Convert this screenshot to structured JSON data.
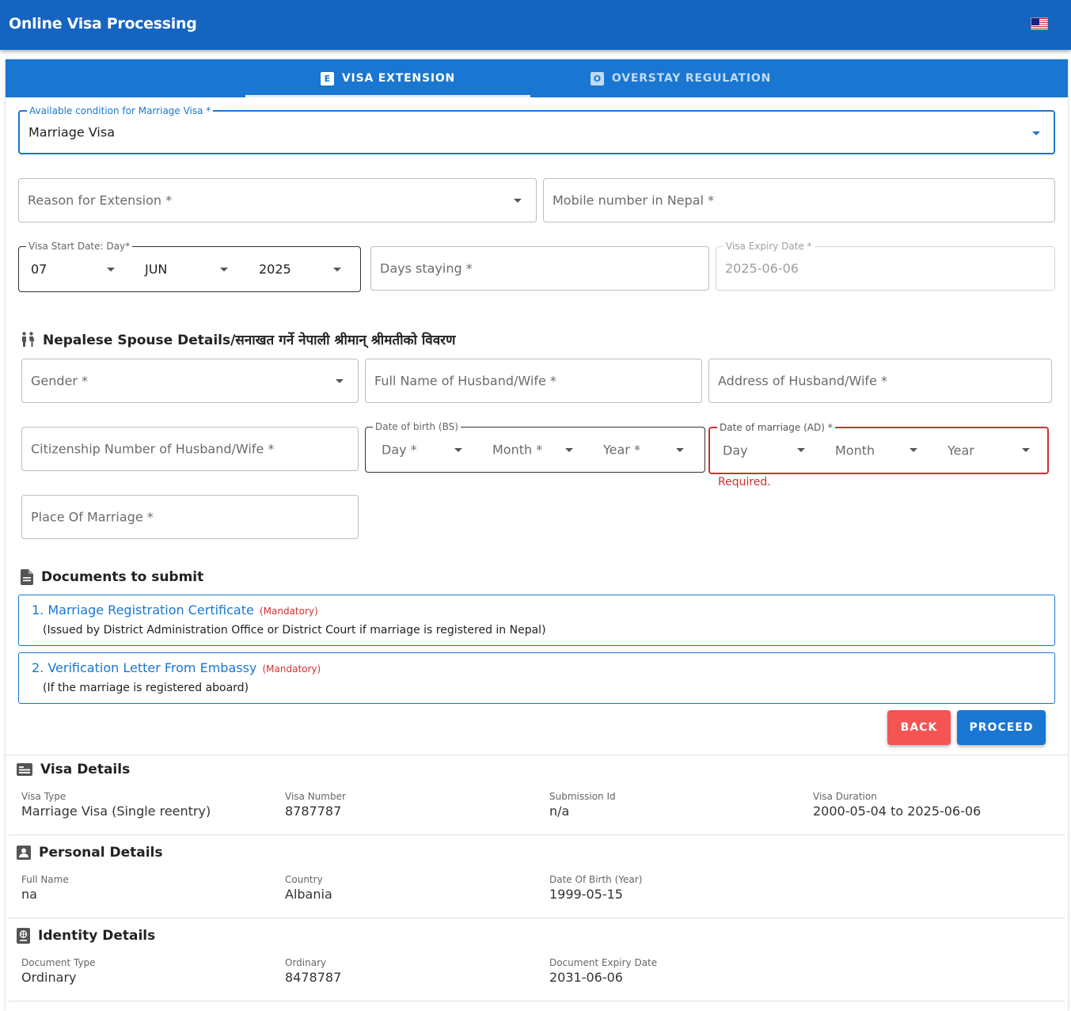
{
  "app": {
    "title": "Online Visa Processing"
  },
  "tabs": [
    {
      "badge": "E",
      "label": "VISA EXTENSION"
    },
    {
      "badge": "O",
      "label": "OVERSTAY REGULATION"
    }
  ],
  "form": {
    "condition": {
      "label": "Available condition for Marriage Visa *",
      "value": "Marriage Visa"
    },
    "reason": {
      "placeholder": "Reason for Extension *"
    },
    "mobile": {
      "placeholder": "Mobile number in Nepal *"
    },
    "visa_start": {
      "label": "Visa Start Date: Day*",
      "day": "07",
      "month": "JUN",
      "year": "2025"
    },
    "days_staying": {
      "placeholder": "Days staying *"
    },
    "visa_expiry": {
      "label": "Visa Expiry Date *",
      "value": "2025-06-06"
    }
  },
  "spouse": {
    "heading": "Nepalese Spouse Details/सनाखत गर्ने नेपाली श्रीमान् श्रीमतीको विवरण",
    "gender": {
      "placeholder": "Gender *"
    },
    "full_name": {
      "placeholder": "Full Name of Husband/Wife *"
    },
    "address": {
      "placeholder": "Address of Husband/Wife *"
    },
    "citizenship": {
      "placeholder": "Citizenship Number of Husband/Wife *"
    },
    "dob": {
      "label": "Date of birth (BS)",
      "day": "Day *",
      "month": "Month *",
      "year": "Year *"
    },
    "marriage_date": {
      "label": "Date of marriage (AD) *",
      "day": "Day",
      "month": "Month",
      "year": "Year",
      "error": "Required."
    },
    "place": {
      "placeholder": "Place Of Marriage *"
    }
  },
  "documents": {
    "heading": "Documents to submit",
    "items": [
      {
        "title": "1. Marriage Registration Certificate",
        "tag": "(Mandatory)",
        "desc": "(Issued by District Administration Office or District Court if marriage is registered in Nepal)"
      },
      {
        "title": "2. Verification Letter From Embassy",
        "tag": "(Mandatory)",
        "desc": "(If the marriage is registered aboard)"
      }
    ]
  },
  "actions": {
    "back": "BACK",
    "proceed": "PROCEED"
  },
  "visa_details": {
    "heading": "Visa Details",
    "fields": [
      {
        "key": "Visa Type",
        "value": "Marriage Visa (Single reentry)"
      },
      {
        "key": "Visa Number",
        "value": "8787787"
      },
      {
        "key": "Submission Id",
        "value": "n/a"
      },
      {
        "key": "Visa Duration",
        "value": "2000-05-04 to 2025-06-06"
      }
    ]
  },
  "personal_details": {
    "heading": "Personal Details",
    "fields": [
      {
        "key": "Full Name",
        "value": "na"
      },
      {
        "key": "Country",
        "value": "Albania"
      },
      {
        "key": "Date Of Birth (Year)",
        "value": "1999-05-15"
      }
    ]
  },
  "identity_details": {
    "heading": "Identity Details",
    "fields": [
      {
        "key": "Document Type",
        "value": "Ordinary"
      },
      {
        "key": "Ordinary",
        "value": "8478787"
      },
      {
        "key": "Document Expiry Date",
        "value": "2031-06-06"
      }
    ]
  },
  "colors": {
    "primary": "#1565c0",
    "tab_bar": "#1976d2",
    "error": "#d32f2f",
    "back_button": "#f55454"
  }
}
